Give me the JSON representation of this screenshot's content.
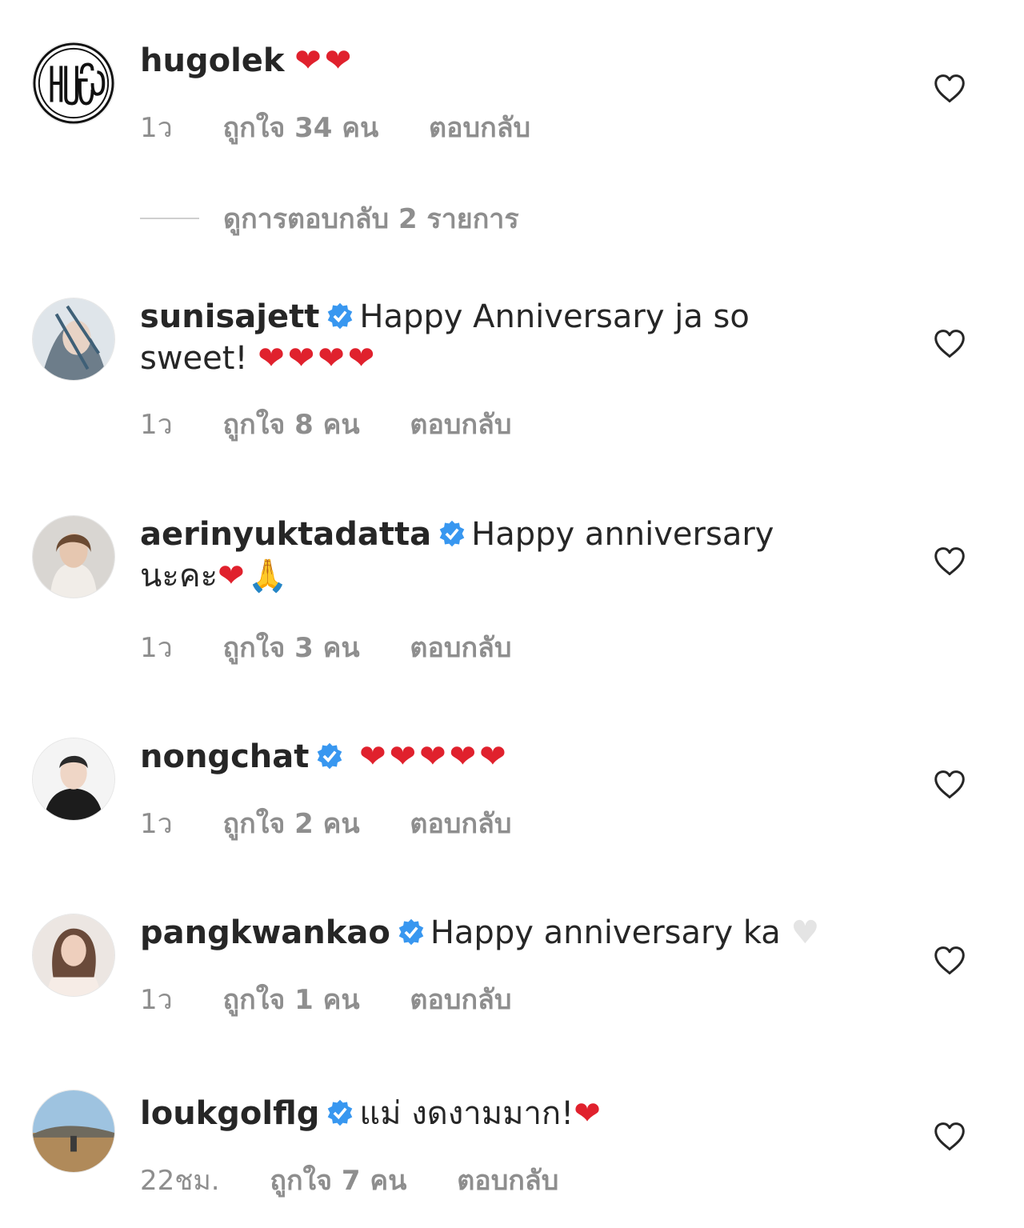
{
  "verified_icon": "verified-badge-icon",
  "like_icon": "heart-outline-icon",
  "colors": {
    "text": "#262626",
    "meta": "#8e8e8e",
    "verified": "#3897f0",
    "heart": "#e0212d"
  },
  "view_replies": "ดูการตอบกลับ 2 รายการ",
  "comments": [
    {
      "username": "hugolek",
      "text": "",
      "emoji": "❤❤",
      "time": "1ว",
      "likes": "ถูกใจ 34 คน",
      "reply": "ตอบกลับ"
    },
    {
      "username": "sunisajett",
      "text": "Happy Anniversary ja so sweet!",
      "emoji": "❤❤❤❤",
      "time": "1ว",
      "likes": "ถูกใจ 8 คน",
      "reply": "ตอบกลับ"
    },
    {
      "username": "aerinyuktadatta",
      "text": "Happy anniversary นะคะ",
      "emoji": "❤🙏",
      "time": "1ว",
      "likes": "ถูกใจ 3 คน",
      "reply": "ตอบกลับ"
    },
    {
      "username": "nongchat",
      "text": "",
      "emoji": "❤❤❤❤❤",
      "time": "1ว",
      "likes": "ถูกใจ 2 คน",
      "reply": "ตอบกลับ"
    },
    {
      "username": "pangkwankao",
      "text": "Happy anniversary ka",
      "emoji": "♥",
      "time": "1ว",
      "likes": "ถูกใจ 1 คน",
      "reply": "ตอบกลับ"
    },
    {
      "username": "loukgolflg",
      "text": "แม่ งดงามมาก!",
      "emoji": "❤",
      "time": "22ชม.",
      "likes": "ถูกใจ 7 คน",
      "reply": "ตอบกลับ"
    }
  ]
}
